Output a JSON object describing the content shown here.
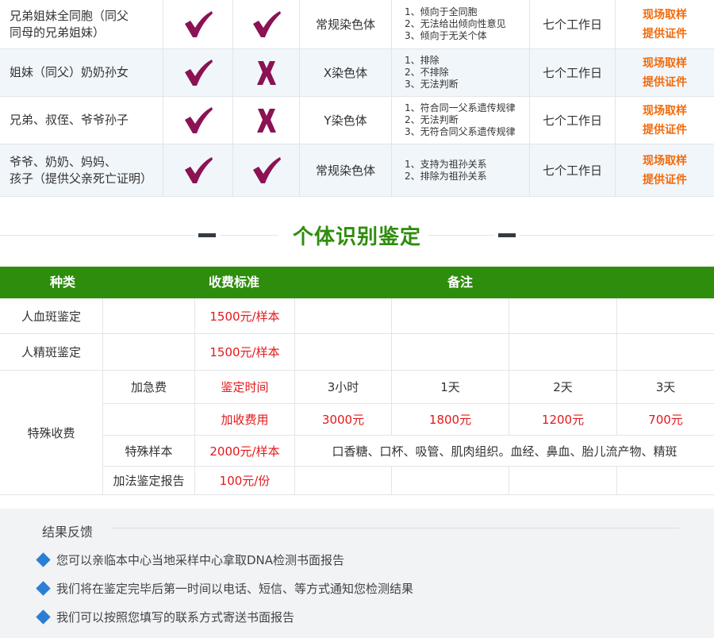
{
  "relationship_rows": [
    {
      "relation": [
        "兄弟姐妹全同胞（同父",
        "同母的兄弟姐妹）"
      ],
      "check1": "check",
      "check2": "check",
      "chromosome": "常规染色体",
      "results": [
        "1、倾向于全同胞",
        "2、无法给出倾向性意见",
        "3、倾向于无关个体"
      ],
      "duration": "七个工作日",
      "notes": [
        "现场取样",
        "提供证件"
      ]
    },
    {
      "relation": [
        "姐妹（同父）奶奶孙女"
      ],
      "check1": "check",
      "check2": "cross",
      "chromosome": "X染色体",
      "results": [
        "1、排除",
        "2、不排除",
        "3、无法判断"
      ],
      "duration": "七个工作日",
      "notes": [
        "现场取样",
        "提供证件"
      ]
    },
    {
      "relation": [
        "兄弟、叔侄、爷爷孙子"
      ],
      "check1": "check",
      "check2": "cross",
      "chromosome": "Y染色体",
      "results": [
        "1、符合同一父系遗传规律",
        "2、无法判断",
        "3、无符合同父系遗传规律"
      ],
      "duration": "七个工作日",
      "notes": [
        "现场取样",
        "提供证件"
      ]
    },
    {
      "relation": [
        "爷爷、奶奶、妈妈、",
        "孩子（提供父亲死亡证明）"
      ],
      "check1": "check",
      "check2": "check",
      "chromosome": "常规染色体",
      "results": [
        "1、支持为祖孙关系",
        "2、排除为祖孙关系"
      ],
      "duration": "七个工作日",
      "notes": [
        "现场取样",
        "提供证件"
      ]
    }
  ],
  "icons": {
    "check": "checkmark-icon",
    "cross": "cross-icon"
  },
  "colors": {
    "green": "#2f8d0d",
    "mark": "#8b1253",
    "orange": "#f26a0b",
    "red": "#e4181b",
    "blue": "#2a7fd4"
  },
  "section": {
    "title": "个体识别鉴定"
  },
  "fee_table": {
    "headers": {
      "category": "种类",
      "standard": "收费标准",
      "remark": "备注"
    },
    "blood": {
      "label": "人血斑鉴定",
      "price": "1500元/样本"
    },
    "semen": {
      "label": "人精斑鉴定",
      "price": "1500元/样本"
    },
    "special": {
      "label": "特殊收费",
      "urgent": {
        "label": "加急费",
        "time_label": "鉴定时间",
        "fee_label": "加收费用",
        "times": [
          "3小时",
          "1天",
          "2天",
          "3天"
        ],
        "fees": [
          "3000元",
          "1800元",
          "1200元",
          "700元"
        ]
      },
      "sample": {
        "label": "特殊样本",
        "price": "2000元/样本",
        "remark": "口香糖、口杯、吸管、肌肉组织。血经、鼻血、胎儿流产物、精斑"
      },
      "report": {
        "label": "加法鉴定报告",
        "price": "100元/份"
      }
    }
  },
  "feedback": {
    "title": "结果反馈",
    "items": [
      "您可以亲临本中心当地采样中心拿取DNA检测书面报告",
      "我们将在鉴定完毕后第一时间以电话、短信、等方式通知您检测结果",
      "我们可以按照您填写的联系方式寄送书面报告"
    ]
  }
}
